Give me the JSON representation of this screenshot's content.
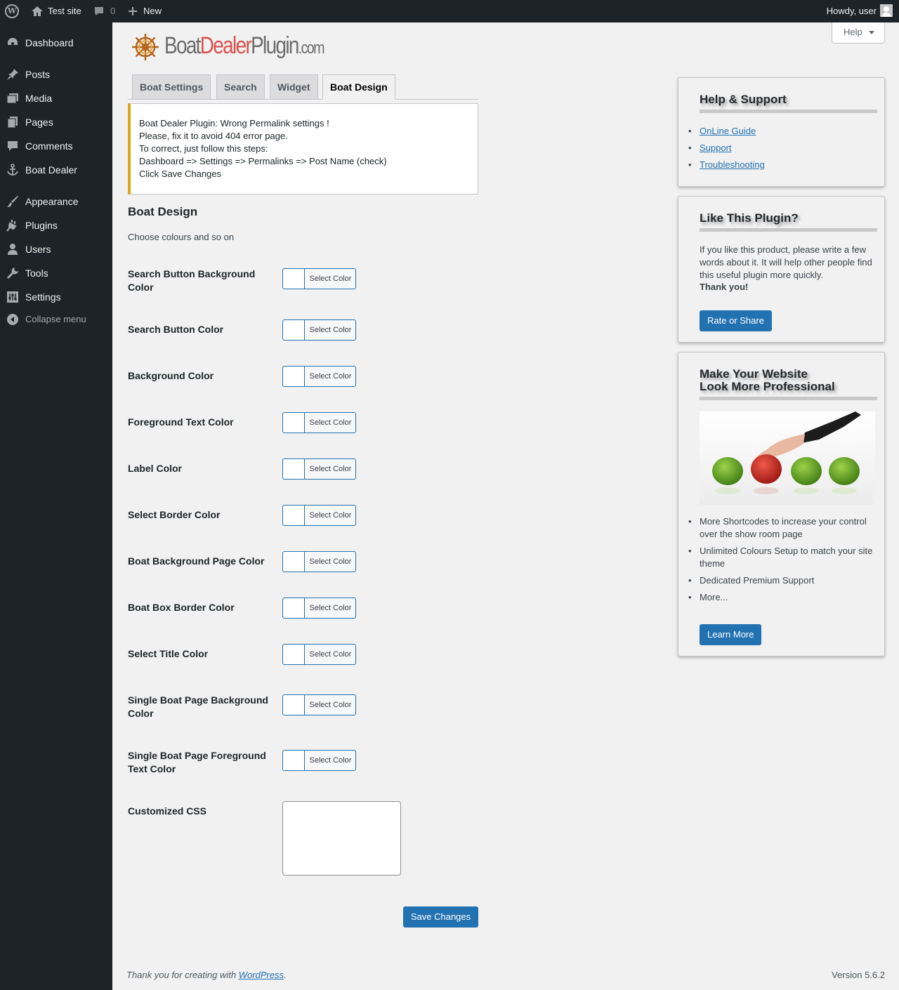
{
  "admin_bar": {
    "site_name": "Test site",
    "comment_count": "0",
    "new_label": "New",
    "howdy": "Howdy, user"
  },
  "menu": {
    "items": [
      {
        "label": "Dashboard",
        "icon": "dashboard-icon"
      },
      {
        "label": "Posts",
        "icon": "pin-icon"
      },
      {
        "label": "Media",
        "icon": "media-icon"
      },
      {
        "label": "Pages",
        "icon": "pages-icon"
      },
      {
        "label": "Comments",
        "icon": "comment-icon"
      },
      {
        "label": "Boat Dealer",
        "icon": "anchor-icon"
      },
      {
        "label": "Appearance",
        "icon": "brush-icon"
      },
      {
        "label": "Plugins",
        "icon": "plug-icon"
      },
      {
        "label": "Users",
        "icon": "user-icon"
      },
      {
        "label": "Tools",
        "icon": "wrench-icon"
      },
      {
        "label": "Settings",
        "icon": "settings-icon"
      }
    ],
    "collapse": "Collapse menu"
  },
  "help_tab": "Help",
  "logo": {
    "part1": "Boat",
    "part2": "Dealer",
    "part3": "Plugin",
    "part4": ".com"
  },
  "tabs": [
    "Boat Settings",
    "Search",
    "Widget",
    "Boat Design"
  ],
  "active_tab": "Boat Design",
  "notice": {
    "lines": [
      "Boat Dealer Plugin: Wrong Permalink settings !",
      "Please, fix it to avoid 404 error page.",
      "To correct, just follow this steps:",
      "Dashboard => Settings => Permalinks => Post Name (check)",
      "Click Save Changes"
    ],
    "accent": "#dba617"
  },
  "section": {
    "title": "Boat Design",
    "description": "Choose colours and so on"
  },
  "select_color_label": "Select Color",
  "fields": [
    "Search Button Background Color",
    "Search Button Color",
    "Background Color",
    "Foreground Text Color",
    "Label Color",
    "Select Border Color",
    "Boat Background Page Color",
    "Boat Box Border Color",
    "Select Title Color",
    "Single Boat Page Background Color",
    "Single Boat Page Foreground Text Color"
  ],
  "css_label": "Customized CSS",
  "css_value": "",
  "save_button": "Save Changes",
  "sidebar": {
    "help": {
      "title": "Help & Support",
      "links": [
        "OnLine Guide",
        "Support",
        "Troubleshooting"
      ]
    },
    "like": {
      "title": "Like This Plugin?",
      "text": "If you like this product, please write a few words about it. It will help other people find this useful plugin more quickly.",
      "thanks": "Thank you!",
      "button": "Rate or Share"
    },
    "pro": {
      "title_line1": "Make Your Website",
      "title_line2": "Look More Professional",
      "features": [
        "More Shortcodes to increase your control over the show room page",
        "Unlimited Colours Setup to match your site theme",
        "Dedicated Premium Support",
        "More..."
      ],
      "button": "Learn More"
    }
  },
  "footer": {
    "thanks_prefix": "Thank you for creating with ",
    "thanks_link": "WordPress",
    "thanks_suffix": ".",
    "version": "Version 5.6.2"
  },
  "colors": {
    "admin_dark": "#1d2327",
    "primary_blue": "#2271b1",
    "logo_red": "#d9534f"
  }
}
